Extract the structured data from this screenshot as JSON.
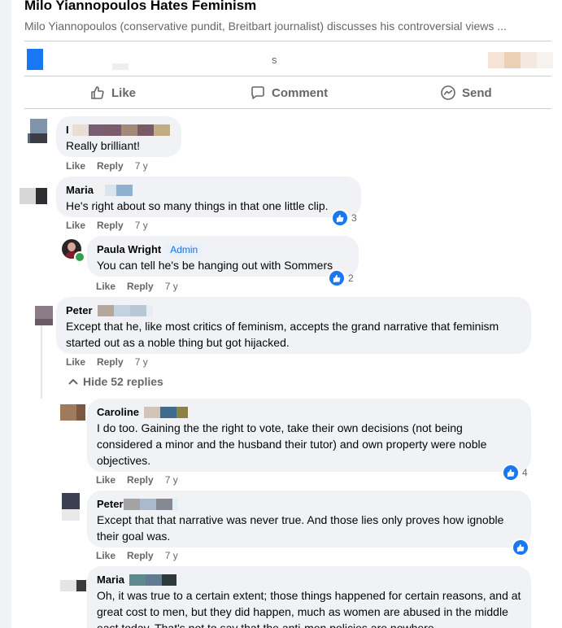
{
  "post": {
    "title": "Milo Yiannopoulos Hates Feminism",
    "description": "Milo Yiannopoulos (conservative pundit, Breitbart journalist) discusses his controversial views ...",
    "reaction_text": "s"
  },
  "actions": {
    "like": "Like",
    "comment": "Comment",
    "send": "Send"
  },
  "hide_replies": "Hide 52 replies",
  "comments": [
    {
      "name": "I",
      "text": "Really brilliant!",
      "like": "Like",
      "reply": "Reply",
      "time": "7 y",
      "count": ""
    },
    {
      "name": "Maria",
      "text": "He's right about so many things in that one little clip.",
      "like": "Like",
      "reply": "Reply",
      "time": "7 y",
      "count": "3"
    },
    {
      "name": "Paula Wright",
      "badge": "Admin",
      "text": "You can tell he's be hanging out with Sommers",
      "like": "Like",
      "reply": "Reply",
      "time": "7 y",
      "count": "2"
    },
    {
      "name": "Peter",
      "text": "Except that he, like most critics of feminism, accepts the grand narrative that feminism started out as a noble thing but got hijacked.",
      "like": "Like",
      "reply": "Reply",
      "time": "7 y",
      "count": ""
    },
    {
      "name": "Caroline",
      "text": "I do too. Gaining the the right to vote, take their own decisions (not being considered a minor and the husband their tutor) and own property were noble objectives.",
      "like": "Like",
      "reply": "Reply",
      "time": "7 y",
      "count": "4"
    },
    {
      "name": "Peter",
      "text": "Except that that narrative was never true. And those lies only proves how ignoble their goal was.",
      "like": "Like",
      "reply": "Reply",
      "time": "7 y",
      "count": ""
    },
    {
      "name": "Maria",
      "text": "Oh, it was true to a certain extent; those things happened for certain reasons, and at great cost to men, but they did happen, much as women are abused in the middle east today. That's not to say that the anti-men policies are nowhere",
      "like": "",
      "reply": "",
      "time": "",
      "count": ""
    }
  ],
  "colors": {
    "accent": "#1877f2",
    "bubble": "#f0f2f5",
    "muted": "#65676b",
    "online": "#31a24c"
  },
  "icons": [
    "thumbs-up-icon",
    "comment-icon",
    "messenger-icon",
    "like-reaction-icon",
    "chevron-up-icon"
  ]
}
